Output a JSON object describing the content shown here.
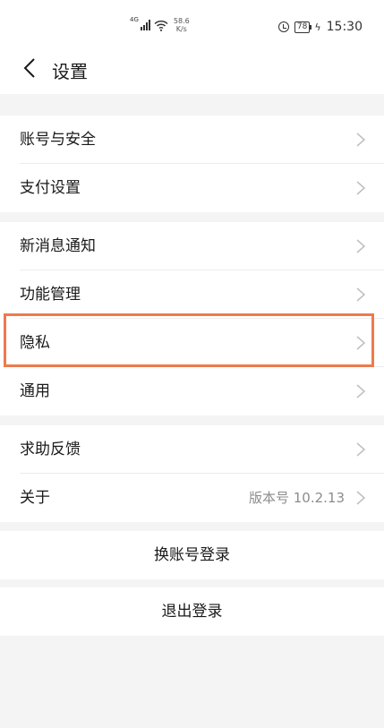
{
  "status_bar": {
    "network_type": "4G",
    "speed_value": "58.6",
    "speed_unit": "K/s",
    "battery_level": "78",
    "time": "15:30"
  },
  "header": {
    "title": "设置"
  },
  "groups": [
    {
      "items": [
        {
          "label": "账号与安全"
        },
        {
          "label": "支付设置"
        }
      ]
    },
    {
      "items": [
        {
          "label": "新消息通知"
        },
        {
          "label": "功能管理"
        },
        {
          "label": "隐私"
        },
        {
          "label": "通用"
        }
      ]
    },
    {
      "items": [
        {
          "label": "求助反馈"
        },
        {
          "label": "关于",
          "value": "版本号 10.2.13"
        }
      ]
    }
  ],
  "actions": {
    "switch_account": "换账号登录",
    "logout": "退出登录"
  },
  "colors": {
    "highlight": "#ee7a4c",
    "background": "#f4f4f4"
  }
}
